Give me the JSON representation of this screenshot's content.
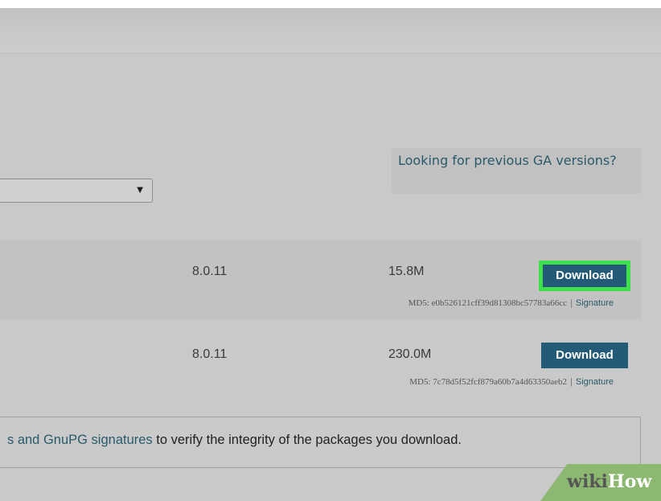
{
  "os_select": {
    "selected_value": ""
  },
  "previous_versions_link": "Looking for previous GA versions?",
  "rows": [
    {
      "version": "8.0.11",
      "size": "15.8M",
      "download_label": "Download",
      "md5": "MD5: e0b526121cff39d81308bc57783a66cc",
      "signature_label": "Signature"
    },
    {
      "version": "8.0.11",
      "size": "230.0M",
      "download_label": "Download",
      "md5": "MD5: 7c78d5f52fcf879a60b7a4d63350aeb2",
      "signature_label": "Signature"
    }
  ],
  "notice": {
    "link_text": "s and GnuPG signatures",
    "rest_text": " to verify the integrity of the packages you download."
  },
  "watermark": {
    "wiki": "wiki",
    "how": "How"
  },
  "colors": {
    "accent": "#225a77",
    "highlight": "#3de04a",
    "link": "#2a5a6a",
    "watermark_green": "#8cb872"
  }
}
